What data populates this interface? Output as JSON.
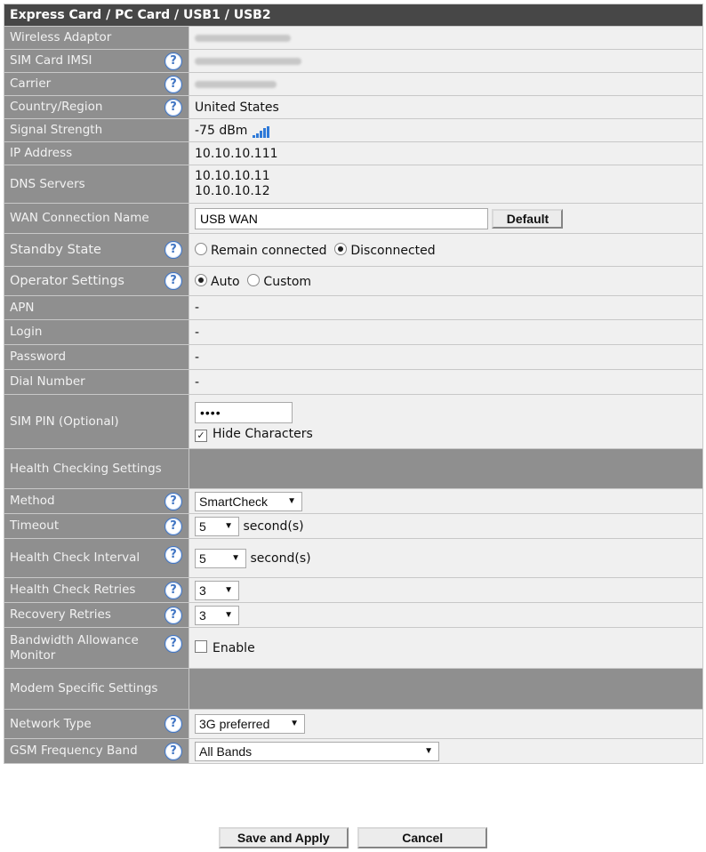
{
  "header": "Express Card / PC Card / USB1 / USB2",
  "labels": {
    "wireless_adaptor": "Wireless Adaptor",
    "sim_imsi": "SIM Card IMSI",
    "carrier": "Carrier",
    "country": "Country/Region",
    "signal": "Signal Strength",
    "ip": "IP Address",
    "dns": "DNS Servers",
    "wan_name": "WAN Connection Name",
    "standby": "Standby State",
    "operator": "Operator Settings",
    "apn": "APN",
    "login": "Login",
    "password": "Password",
    "dial": "Dial Number",
    "sim_pin": "SIM PIN (Optional)",
    "health_group": "Health Checking Settings",
    "method": "Method",
    "timeout": "Timeout",
    "hc_interval": "Health Check Interval",
    "hc_retries": "Health Check Retries",
    "recovery": "Recovery Retries",
    "bandwidth": "Bandwidth Allowance Monitor",
    "modem_group": "Modem Specific Settings",
    "network_type": "Network Type",
    "gsm_band": "GSM Frequency Band"
  },
  "values": {
    "country": "United States",
    "signal": "-75 dBm",
    "ip": "10.10.10.111",
    "dns1": "10.10.10.11",
    "dns2": "10.10.10.12",
    "wan_name": "USB WAN",
    "apn": "-",
    "login": "-",
    "password": "-",
    "dial": "-",
    "sim_pin": "••••",
    "method": "SmartCheck",
    "timeout": "5",
    "timeout_unit": "second(s)",
    "hc_interval": "5",
    "hc_interval_unit": "second(s)",
    "hc_retries": "3",
    "recovery": "3",
    "network_type": "3G preferred",
    "gsm_band": "All Bands"
  },
  "options": {
    "standby_connected": "Remain connected",
    "standby_disconnected": "Disconnected",
    "op_auto": "Auto",
    "op_custom": "Custom",
    "hide_chars": "Hide Characters",
    "enable": "Enable"
  },
  "state": {
    "standby_selected": "Disconnected",
    "operator_selected": "Auto",
    "hide_chars_checked": true,
    "bandwidth_enabled": false
  },
  "buttons": {
    "default": "Default",
    "save": "Save and Apply",
    "cancel": "Cancel"
  },
  "icons": {
    "help": "?",
    "help_name": "question-mark-icon",
    "signal_name": "signal-bars-icon"
  },
  "colors": {
    "header": "#474747",
    "label_bg": "#8f8f8f",
    "value_bg": "#f0f0f0",
    "help": "#3f74c3",
    "signal": "#2f7ad8"
  }
}
